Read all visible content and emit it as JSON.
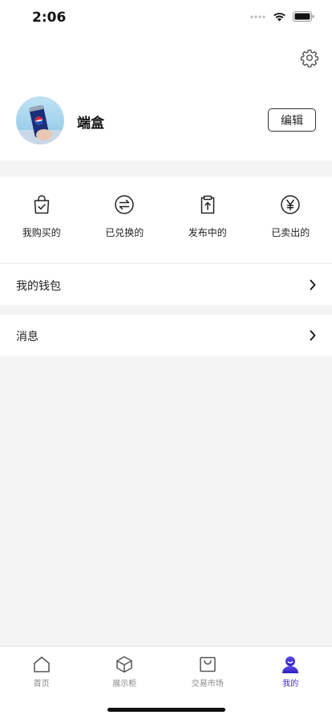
{
  "status_bar": {
    "time": "2:06"
  },
  "profile": {
    "username": "端盒",
    "edit_label": "编辑"
  },
  "orders": [
    {
      "label": "我购买的",
      "icon": "shopping-bag-check-icon"
    },
    {
      "label": "已兑换的",
      "icon": "exchange-icon"
    },
    {
      "label": "发布中的",
      "icon": "clipboard-upload-icon"
    },
    {
      "label": "已卖出的",
      "icon": "yen-icon"
    }
  ],
  "menu": {
    "wallet_label": "我的钱包",
    "messages_label": "消息"
  },
  "tab_bar": {
    "tabs": [
      {
        "label": "首页",
        "icon": "home-icon"
      },
      {
        "label": "展示柜",
        "icon": "cube-icon"
      },
      {
        "label": "交易市场",
        "icon": "bag-icon"
      },
      {
        "label": "我的",
        "icon": "user-icon"
      }
    ],
    "active_index": 3
  },
  "colors": {
    "accent": "#3d2fd3",
    "background": "#f4f4f4"
  }
}
